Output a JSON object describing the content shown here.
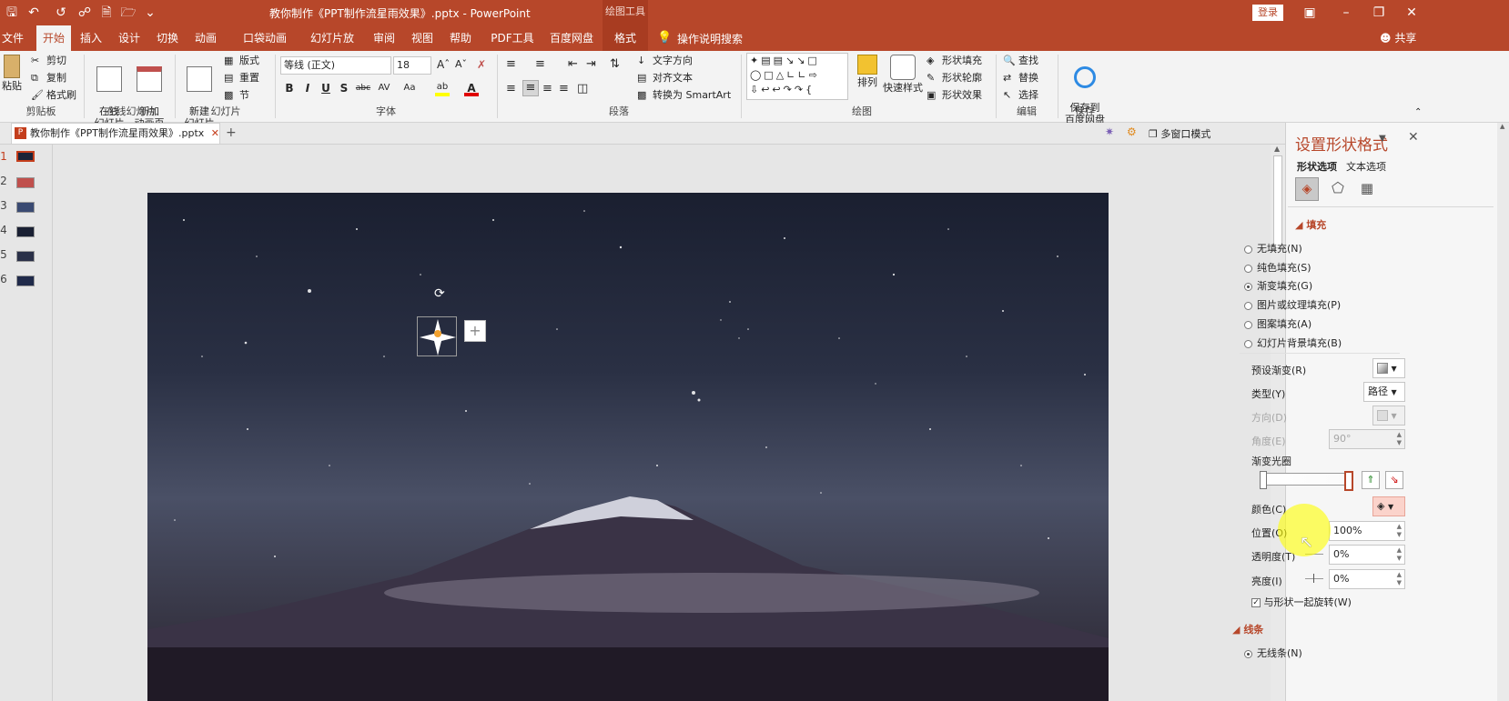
{
  "titlebar": {
    "doc_title": "教你制作《PPT制作流星雨效果》.pptx - PowerPoint",
    "context_label": "绘图工具",
    "login_button": "登录"
  },
  "tabs": [
    "文件",
    "开始",
    "插入",
    "设计",
    "切换",
    "动画",
    "口袋动画 PA",
    "幻灯片放映",
    "审阅",
    "视图",
    "帮助",
    "PDF工具集",
    "百度网盘",
    "格式"
  ],
  "tell_me": "操作说明搜索",
  "share": "共享",
  "ribbon": {
    "clipboard": {
      "paste": "粘贴",
      "cut": "剪切",
      "copy": "复制",
      "format_painter": "格式刷",
      "label": "剪贴板"
    },
    "online": {
      "online_slides": "在线\n幻灯片",
      "new_anim": "新加\n动画页",
      "label": "在线幻灯片"
    },
    "slides": {
      "new_slide": "新建\n幻灯片",
      "layout": "版式",
      "reset": "重置",
      "section": "节",
      "label": "幻灯片"
    },
    "font": {
      "font_name": "等线 (正文)",
      "font_size": "18",
      "bold": "B",
      "italic": "I",
      "underline": "U",
      "shadow": "S",
      "strike": "abc",
      "spacing": "AV",
      "case": "Aa",
      "label": "字体"
    },
    "paragraph": {
      "text_dir": "文字方向",
      "align_text": "对齐文本",
      "smartart": "转换为 SmartArt",
      "label": "段落"
    },
    "drawing": {
      "arrange": "排列",
      "quick_styles": "快速样式",
      "shape_fill": "形状填充",
      "shape_outline": "形状轮廓",
      "shape_effects": "形状效果",
      "label": "绘图"
    },
    "editing": {
      "find": "查找",
      "replace": "替换",
      "select": "选择",
      "label": "编辑"
    },
    "save": {
      "save_baidu": "保存到\n百度网盘",
      "label": "保存"
    }
  },
  "doc_tab": {
    "name": "教你制作《PPT制作流星雨效果》.pptx",
    "multiwin": "多窗口模式"
  },
  "thumbnails": [
    "1",
    "2",
    "3",
    "4",
    "5",
    "6"
  ],
  "pane": {
    "title": "设置形状格式",
    "tab_shape": "形状选项",
    "tab_text": "文本选项",
    "fill_header": "填充",
    "fill_options": [
      {
        "label": "无填充(N)",
        "selected": false
      },
      {
        "label": "纯色填充(S)",
        "selected": false
      },
      {
        "label": "渐变填充(G)",
        "selected": true
      },
      {
        "label": "图片或纹理填充(P)",
        "selected": false
      },
      {
        "label": "图案填充(A)",
        "selected": false
      },
      {
        "label": "幻灯片背景填充(B)",
        "selected": false
      }
    ],
    "preset_label": "预设渐变(R)",
    "type_label": "类型(Y)",
    "type_value": "路径",
    "direction_label": "方向(D)",
    "angle_label": "角度(E)",
    "angle_value": "90°",
    "stops_label": "渐变光圈",
    "color_label": "颜色(C)",
    "position_label": "位置(O)",
    "position_value": "100%",
    "transparency_label": "透明度(T)",
    "transparency_value": "0%",
    "brightness_label": "亮度(I)",
    "brightness_value": "0%",
    "rotate_label": "与形状一起旋转(W)",
    "line_header": "线条",
    "no_line": "无线条(N)"
  },
  "colors": {
    "accent": "#b7472a"
  }
}
